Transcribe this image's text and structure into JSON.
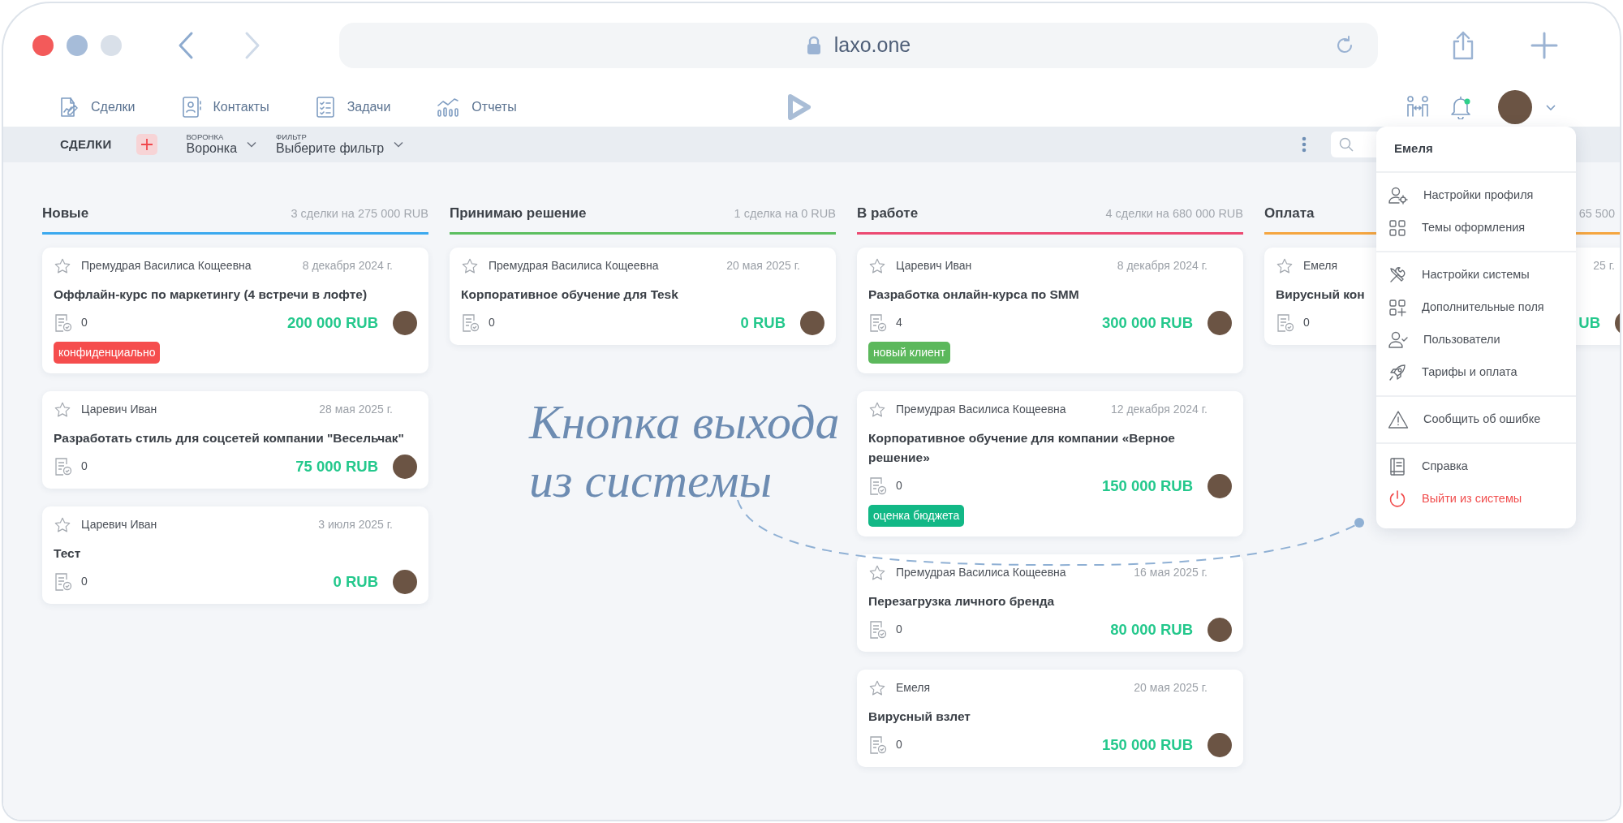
{
  "browser": {
    "url": "laxo.one"
  },
  "nav": {
    "items": [
      {
        "label": "Сделки"
      },
      {
        "label": "Контакты"
      },
      {
        "label": "Задачи"
      },
      {
        "label": "Отчеты"
      }
    ]
  },
  "toolbar": {
    "title": "СДЕЛКИ",
    "pipeline": {
      "label": "ВОРОНКА",
      "value": "Воронка"
    },
    "filter": {
      "label": "ФИЛЬТР",
      "value": "Выберите фильтр"
    }
  },
  "columns": [
    {
      "title": "Новые",
      "summary": "3 сделки на 275 000 RUB",
      "color": "#3ba9ef",
      "cards": [
        {
          "author": "Премудрая Василиса Кощеевна",
          "date": "8 декабря 2024 г.",
          "title": "Оффлайн-курс по маркетингу (4 встречи в лофте)",
          "count": "0",
          "amount": "200 000 RUB",
          "tag": {
            "text": "конфиденциально",
            "color": "#f54d4d"
          }
        },
        {
          "author": "Царевич Иван",
          "date": "28 мая 2025 г.",
          "title": "Разработать стиль для соцсетей компании \"Весельчак\"",
          "count": "0",
          "amount": "75 000 RUB"
        },
        {
          "author": "Царевич Иван",
          "date": "3 июля 2025 г.",
          "title": "Тест",
          "count": "0",
          "amount": "0 RUB"
        }
      ]
    },
    {
      "title": "Принимаю решение",
      "summary": "1 сделка на 0 RUB",
      "color": "#5cbf60",
      "cards": [
        {
          "author": "Премудрая Василиса Кощеевна",
          "date": "20 мая 2025 г.",
          "title": "Корпоративное обучение для Tesk",
          "count": "0",
          "amount": "0 RUB"
        }
      ]
    },
    {
      "title": "В работе",
      "summary": "4 сделки на 680 000 RUB",
      "color": "#ec4a72",
      "cards": [
        {
          "author": "Царевич Иван",
          "date": "8 декабря 2024 г.",
          "title": "Разработка онлайн-курса по SMM",
          "count": "4",
          "amount": "300 000 RUB",
          "tag": {
            "text": "новый клиент",
            "color": "#5cb85c"
          }
        },
        {
          "author": "Премудрая Василиса Кощеевна",
          "date": "12 декабря 2024 г.",
          "title": "Корпоративное обучение для компании «Верное решение»",
          "count": "0",
          "amount": "150 000 RUB",
          "tag": {
            "text": "оценка бюджета",
            "color": "#12b886"
          }
        },
        {
          "author": "Премудрая Василиса Кощеевна",
          "date": "16 мая 2025 г.",
          "title": "Перезагрузка личного бренда",
          "count": "0",
          "amount": "80 000 RUB"
        },
        {
          "author": "Емеля",
          "date": "20 мая 2025 г.",
          "title": "Вирусный взлет",
          "count": "0",
          "amount": "150 000 RUB"
        }
      ]
    },
    {
      "title": "Оплата",
      "summary": "65 500",
      "color": "#f5a640",
      "cards": [
        {
          "author": "Емеля",
          "date": "25 г.",
          "title": "Вирусный кон",
          "count": "0",
          "amount": "UB"
        }
      ]
    }
  ],
  "user_menu": {
    "user": "Емеля",
    "groups": [
      [
        {
          "label": "Настройки профиля",
          "kind": "normal"
        },
        {
          "label": "Темы оформления",
          "kind": "normal"
        }
      ],
      [
        {
          "label": "Настройки системы",
          "kind": "normal"
        },
        {
          "label": "Дополнительные поля",
          "kind": "normal"
        },
        {
          "label": "Пользователи",
          "kind": "normal"
        },
        {
          "label": "Тарифы и оплата",
          "kind": "normal"
        }
      ],
      [
        {
          "label": "Сообщить об ошибке",
          "kind": "normal"
        }
      ],
      [
        {
          "label": "Справка",
          "kind": "normal"
        },
        {
          "label": "Выйти из системы",
          "kind": "danger"
        }
      ]
    ]
  },
  "annotation": {
    "lines": [
      "Кнопка выхода",
      "из системы"
    ]
  }
}
